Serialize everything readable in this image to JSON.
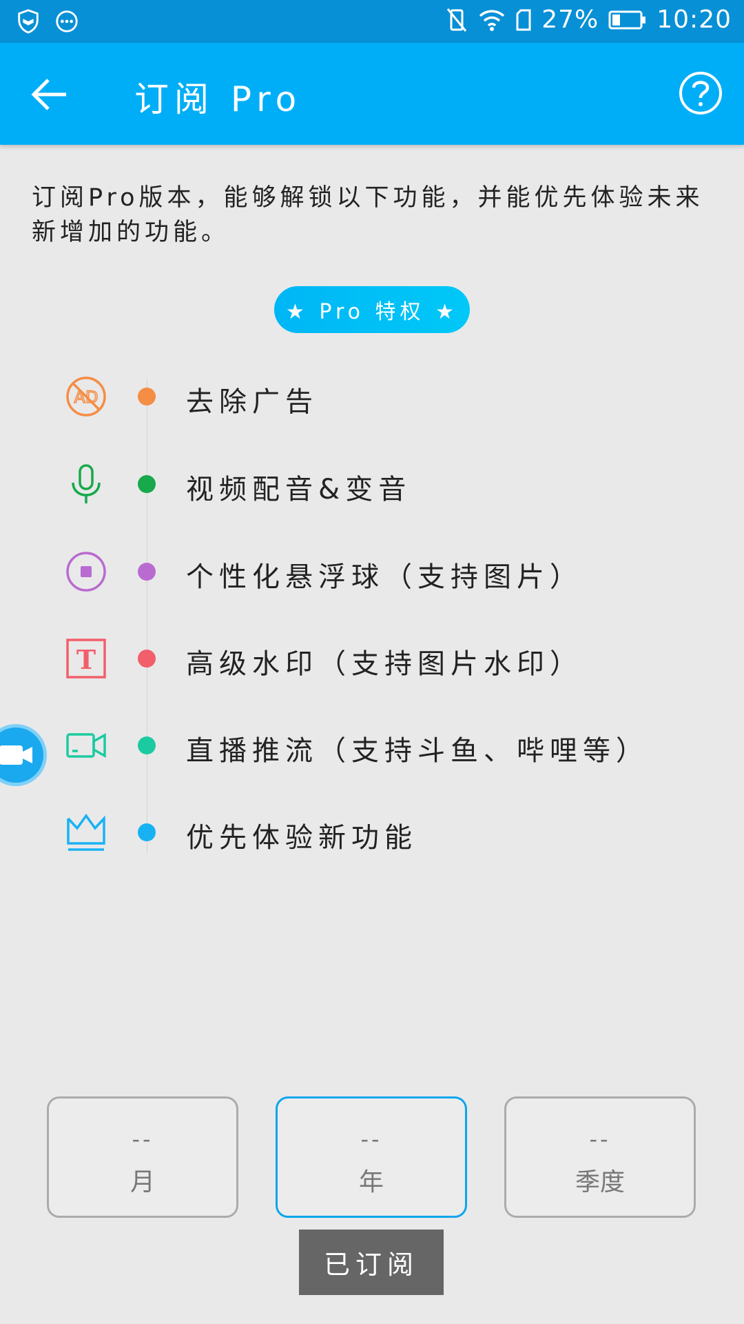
{
  "status_bar": {
    "left_icons": [
      "shield-icon",
      "chat-bubble-icon"
    ],
    "right_icons": [
      "vibrate-icon",
      "wifi-icon",
      "sim-icon",
      "battery-icon"
    ],
    "battery_text": "27%",
    "time": "10:20"
  },
  "app_bar": {
    "title": "订阅 Pro",
    "back_icon": "arrow-left-icon",
    "help_icon": "help-circle-icon"
  },
  "description": "订阅Pro版本，能够解锁以下功能，并能优先体验未来新增加的功能。",
  "pro_badge": "★ Pro 特权 ★",
  "features": [
    {
      "label": "去除广告",
      "icon": "no-ad-icon",
      "color": "#f58d45"
    },
    {
      "label": "视频配音&变音",
      "icon": "microphone-icon",
      "color": "#17a94a"
    },
    {
      "label": "个性化悬浮球（支持图片）",
      "icon": "stop-circle-icon",
      "color": "#b96bcf"
    },
    {
      "label": "高级水印（支持图片水印）",
      "icon": "text-t-icon",
      "color": "#f15f6a"
    },
    {
      "label": "直播推流（支持斗鱼、哔哩等）",
      "icon": "video-camera-icon",
      "color": "#1ccaa0"
    },
    {
      "label": "优先体验新功能",
      "icon": "crown-icon",
      "color": "#18b2f3"
    }
  ],
  "plans": [
    {
      "price": "--",
      "name": "月",
      "selected": false
    },
    {
      "price": "--",
      "name": "年",
      "selected": true
    },
    {
      "price": "--",
      "name": "季度",
      "selected": false
    }
  ],
  "subscribed_button": "已订阅",
  "colors": {
    "status_bar": "#0790d6",
    "app_bar": "#00aef7",
    "background": "#e9e9ea",
    "selected_plan_border": "#0aa6ec",
    "subscribed_button": "#666666"
  }
}
